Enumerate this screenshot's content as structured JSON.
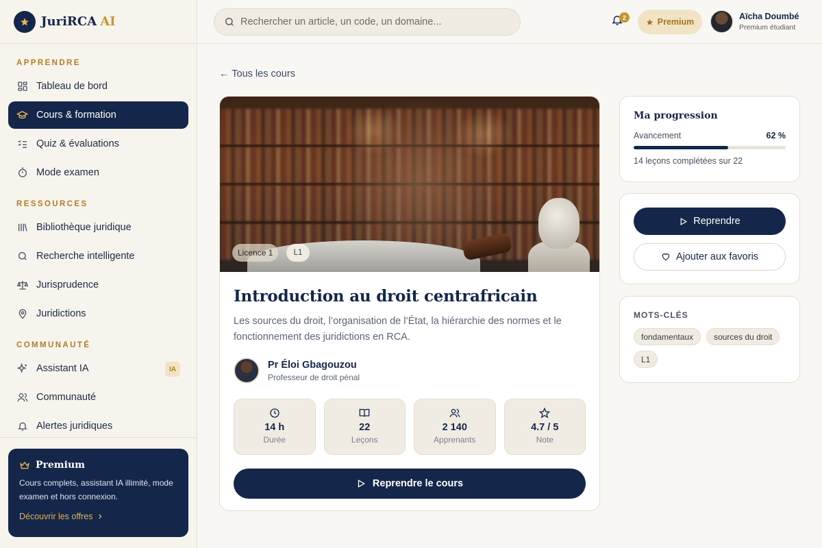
{
  "brand": {
    "name": "JuriRCA",
    "suffix": "AI"
  },
  "search": {
    "placeholder": "Rechercher un article, un code, un domaine..."
  },
  "header": {
    "notification_count": "2",
    "premium_label": "Premium",
    "user": {
      "name": "Aïcha Doumbé",
      "role": "Premium étudiant"
    }
  },
  "sidebar": {
    "sections": [
      {
        "title": "APPRENDRE",
        "items": [
          {
            "label": "Tableau de bord",
            "icon": "dashboard-icon"
          },
          {
            "label": "Cours & formation",
            "icon": "graduation-cap-icon",
            "active": true
          },
          {
            "label": "Quiz & évaluations",
            "icon": "checklist-icon"
          },
          {
            "label": "Mode examen",
            "icon": "timer-icon"
          }
        ]
      },
      {
        "title": "RESSOURCES",
        "items": [
          {
            "label": "Bibliothèque juridique",
            "icon": "library-icon"
          },
          {
            "label": "Recherche intelligente",
            "icon": "search-icon"
          },
          {
            "label": "Jurisprudence",
            "icon": "scales-icon"
          },
          {
            "label": "Juridictions",
            "icon": "map-pin-icon"
          }
        ]
      },
      {
        "title": "COMMUNAUTÉ",
        "items": [
          {
            "label": "Assistant IA",
            "icon": "sparkles-icon",
            "badge": "IA"
          },
          {
            "label": "Communauté",
            "icon": "users-icon"
          },
          {
            "label": "Alertes juridiques",
            "icon": "bell-icon"
          }
        ]
      }
    ],
    "promo": {
      "title": "Premium",
      "text": "Cours complets, assistant IA illimité, mode examen et hors connexion.",
      "link": "Découvrir les offres"
    }
  },
  "main": {
    "back_link": "← Tous les cours",
    "course": {
      "level_tag": "Licence 1",
      "level_chip": "L1",
      "title": "Introduction au droit centrafricain",
      "description": "Les sources du droit, l’organisation de l’État, la hiérarchie des normes et le fonctionnement des juridictions en RCA.",
      "author": {
        "name": "Pr Éloi Gbagouzou",
        "role": "Professeur de droit pénal"
      },
      "stats": [
        {
          "value": "14 h",
          "label": "Durée",
          "icon": "clock-icon"
        },
        {
          "value": "22",
          "label": "Leçons",
          "icon": "book-icon"
        },
        {
          "value": "2 140",
          "label": "Apprenants",
          "icon": "users-icon"
        },
        {
          "value": "4.7 / 5",
          "label": "Note",
          "icon": "star-icon"
        }
      ],
      "resume_button": "Reprendre le cours"
    }
  },
  "progress": {
    "title": "Ma progression",
    "label": "Avancement",
    "percent_text": "62 %",
    "percent": 62,
    "summary": "14 leçons complétées sur 22"
  },
  "actions": {
    "resume": "Reprendre",
    "favorite": "Ajouter aux favoris"
  },
  "keywords": {
    "title": "MOTS-CLÉS",
    "items": [
      "fondamentaux",
      "sources du droit",
      "L1"
    ]
  },
  "colors": {
    "navy": "#14264a",
    "gold": "#c4962f",
    "cream": "#f9f7f3"
  }
}
